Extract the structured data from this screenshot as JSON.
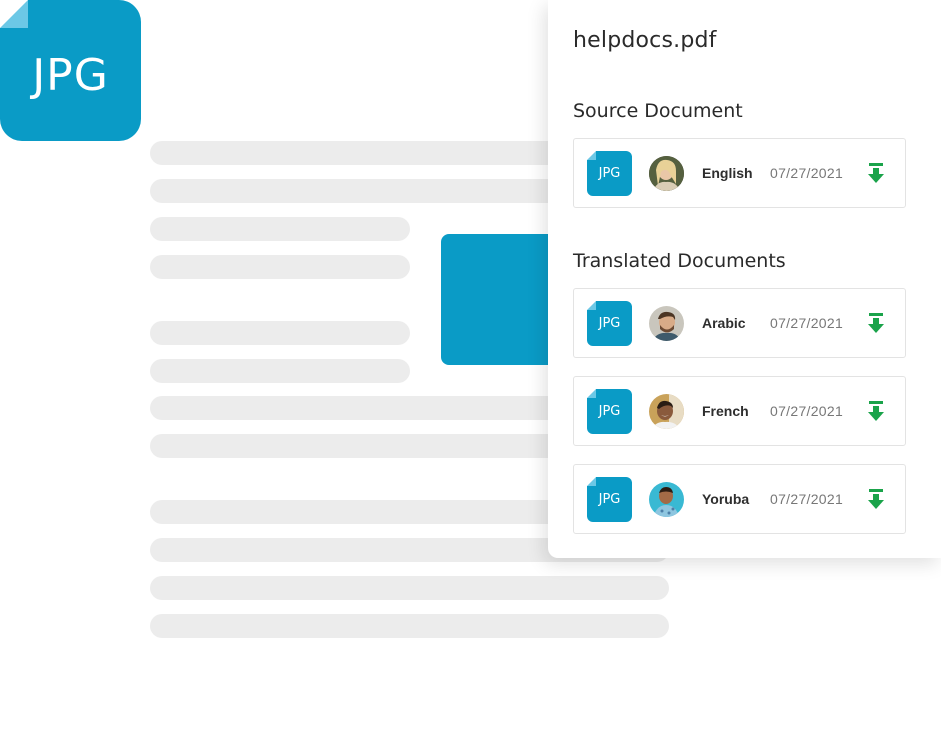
{
  "badge": {
    "label": "JPG"
  },
  "panel": {
    "filename": "helpdocs.pdf",
    "source_title": "Source Document",
    "translated_title": "Translated Documents",
    "source": {
      "file_type": "JPG",
      "language": "English",
      "date": "07/27/2021"
    },
    "translated": [
      {
        "file_type": "JPG",
        "language": "Arabic",
        "date": "07/27/2021"
      },
      {
        "file_type": "JPG",
        "language": "French",
        "date": "07/27/2021"
      },
      {
        "file_type": "JPG",
        "language": "Yoruba",
        "date": "07/27/2021"
      }
    ]
  },
  "colors": {
    "brand_blue": "#0a9bc6",
    "download_green": "#1aa34a",
    "placeholder_gray": "#ececec"
  },
  "icons": {
    "file": "jpg-file-icon",
    "download": "download-arrow-icon",
    "avatar": "user-avatar"
  }
}
